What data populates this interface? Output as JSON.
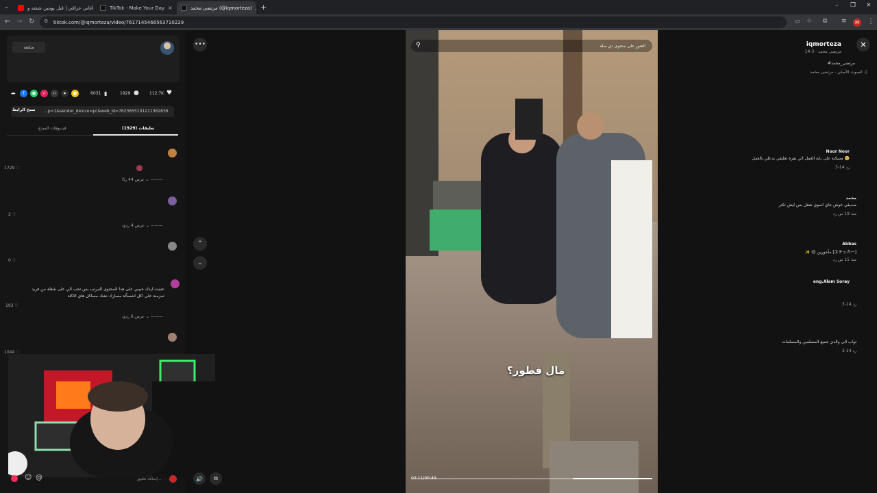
{
  "browser": {
    "tabs": [
      {
        "title": "اغاني عراقي | قبل يومين شفته و...",
        "favicon_color": "#ff0000",
        "active": false
      },
      {
        "title": "TikTok - Make Your Day",
        "favicon_color": "#111111",
        "active": false
      },
      {
        "title": "مرتضى محمد (@iqmorteza)",
        "favicon_color": "#111111",
        "active": true
      }
    ],
    "url": "tiktok.com/@iqmorteza/video/7617145466563710229",
    "profile_initial": "M",
    "new_tab": "+",
    "close_tab": "×"
  },
  "author": {
    "username": "iqmorteza",
    "display_meta": "مرتضى محمد · 3-14",
    "follow_label": "متابعة",
    "hashtag": "#مرتضى_محمد",
    "sound": "الصوت الأصلي - مرتضى محمد"
  },
  "stats": {
    "likes": "112.7K",
    "comments": "1929",
    "saves": "6031"
  },
  "share": {
    "link": "...p=1&sender_device=pc&web_id=7623655101211362836",
    "copy_label": "نسخ الرابط"
  },
  "tabs": {
    "comments_label": "تعليقات (1929)",
    "creator_videos_label": "فيديوهات المبدع"
  },
  "comments": [
    {
      "user": "Noor Noor",
      "text": "مسكنة على بابة العمل الي يفرة تعليقي يدعلي بالعمل 🥺",
      "meta": "3-14 رد",
      "likes": "1729",
      "replies": "عرض 44 ردًا",
      "avatar_color": "#c08040"
    },
    {
      "user": "محمد",
      "text": "صديقي خوش جاي اسوي شغل بس ليش تكتر",
      "meta": "منذ 19 س رد",
      "likes": "2",
      "replies": "عرض 4 ردود",
      "avatar_color": "#7a5fa0"
    },
    {
      "user": "Abbas",
      "text": "✨ 😍 مأجورين [ステッカー]",
      "meta": "منذ 15 س رد",
      "likes": "0",
      "replies": "",
      "avatar_color": "#888888"
    },
    {
      "user": "eng.Alem Soray",
      "text": "عشت ايدك حبيبي على هذا المحتوى المرتب بس تحب الي على شغلة من فريد تمزمنة على اكل اشسألة مسارك تشك مساكل هاي الاكلة",
      "meta": "3-14 رد",
      "likes": "193",
      "replies": "عرض 6 ردود",
      "avatar_color": "#b0409a"
    },
    {
      "user": "",
      "text": "ثواب الى والدي جميع المسلمين والمسلمات",
      "meta": "3-14 رد",
      "likes": "1044",
      "replies": "",
      "avatar_color": "#a08070"
    }
  ],
  "video": {
    "search_placeholder": "العثور على محتوى ذي صلة",
    "caption": "مال فطور؟",
    "time": "02:11/00:49",
    "progress": 0.67
  },
  "comment_input": {
    "placeholder": "إضافة تعليق..."
  },
  "colors": {
    "accent": "#fe2c55",
    "background": "#121212",
    "panel": "#151515"
  }
}
